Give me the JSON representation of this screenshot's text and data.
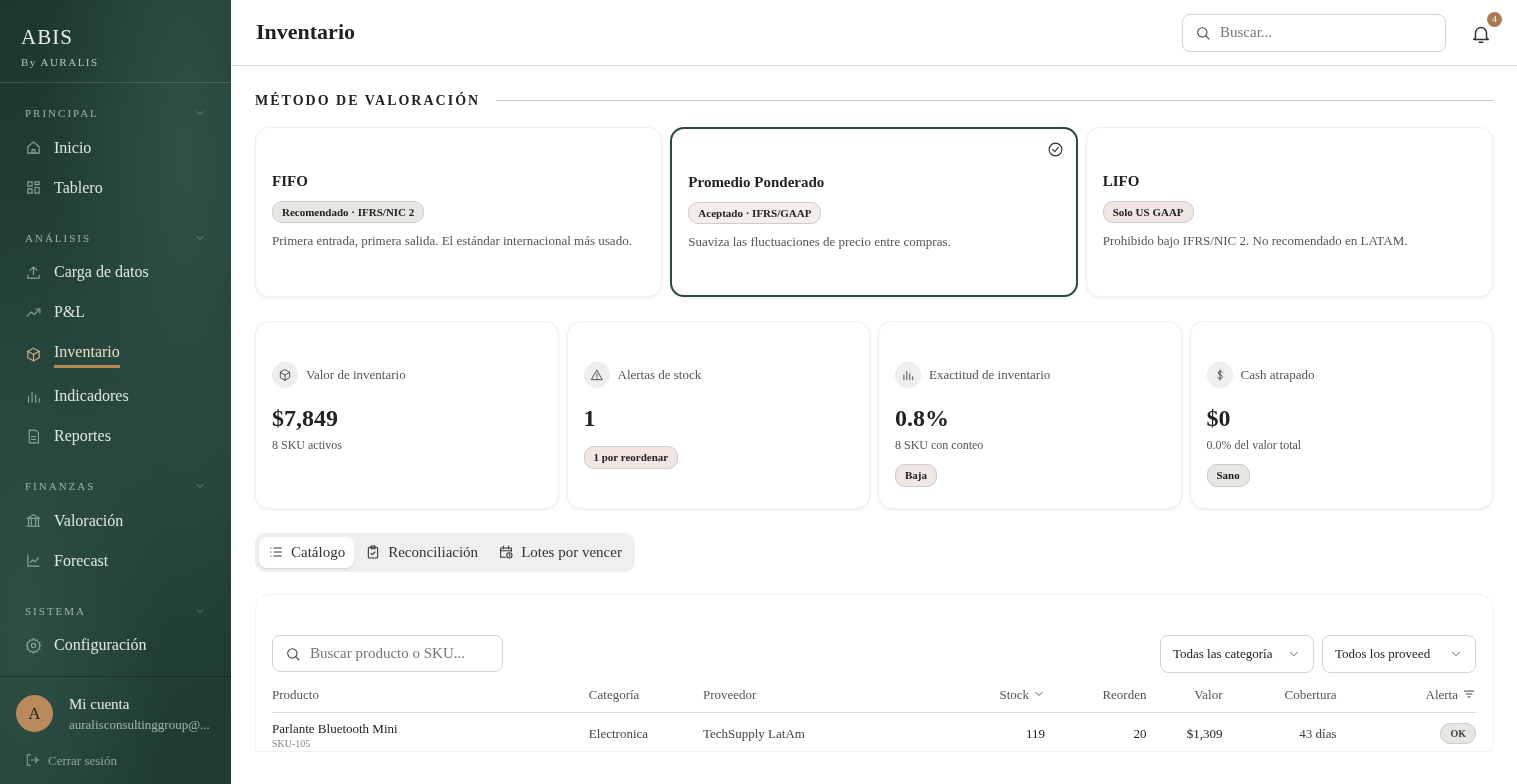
{
  "brand": {
    "name": "ABIS",
    "tagline": "By AURALIS"
  },
  "sidebar": {
    "sections": [
      {
        "label": "PRINCIPAL",
        "expanded": true,
        "items": [
          {
            "label": "Inicio",
            "selected": false
          },
          {
            "label": "Tablero",
            "selected": false
          }
        ]
      },
      {
        "label": "ANÁLISIS",
        "expanded": true,
        "items": [
          {
            "label": "Carga de datos",
            "selected": false
          },
          {
            "label": "P&L",
            "selected": false
          },
          {
            "label": "Inventario",
            "selected": true
          },
          {
            "label": "Indicadores",
            "selected": false
          },
          {
            "label": "Reportes",
            "selected": false
          }
        ]
      },
      {
        "label": "FINANZAS",
        "expanded": true,
        "items": [
          {
            "label": "Valoración",
            "selected": false
          },
          {
            "label": "Forecast",
            "selected": false
          }
        ]
      },
      {
        "label": "SISTEMA",
        "expanded": true,
        "items": [
          {
            "label": "Configuración",
            "selected": false
          }
        ]
      }
    ]
  },
  "account": {
    "initial": "A",
    "name": "Mi cuenta",
    "email": "auralisconsultinggroup@...",
    "logout": "Cerrar sesión"
  },
  "header": {
    "title": "Inventario",
    "search_placeholder": "Buscar...",
    "notifications": "4"
  },
  "valuation": {
    "title": "MÉTODO DE VALORACIÓN",
    "methods": [
      {
        "name": "FIFO",
        "badge": "Recomendado · IFRS/NIC 2",
        "color": "#e4e7e2",
        "description": "Primera entrada, primera salida. El estándar internacional más usado.",
        "selected": false
      },
      {
        "name": "Promedio Ponderado",
        "badge": "Aceptado · IFRS/GAAP",
        "color": "#f5ede9",
        "description": "Suaviza las fluctuaciones de precio entre compras.",
        "selected": true
      },
      {
        "name": "LIFO",
        "badge": "Solo US GAAP",
        "color": "#f0e6e2",
        "description": "Prohibido bajo IFRS/NIC 2. No recomendado en LATAM.",
        "selected": false
      }
    ]
  },
  "kpis": [
    {
      "label": "Valor de inventario",
      "value": "$7,849",
      "sub": "8 SKU activos"
    },
    {
      "label": "Alertas de stock",
      "value": "1",
      "badge": "1 por reordenar",
      "color": "#f3e6e2"
    },
    {
      "label": "Exactitud de inventario",
      "value": "0.8%",
      "sub": "8 SKU con conteo",
      "badge": "Baja",
      "color": "#f1e7e3"
    },
    {
      "label": "Cash atrapado",
      "value": "$0",
      "sub": "0.0% del valor total",
      "badge": "Sano",
      "color": "#e4e7e2"
    }
  ],
  "tabs": [
    {
      "label": "Catálogo",
      "selected": true
    },
    {
      "label": "Reconciliación",
      "selected": false
    },
    {
      "label": "Lotes por vencer",
      "selected": false
    }
  ],
  "table": {
    "search_placeholder": "Buscar producto o SKU...",
    "filters": [
      "Todas las categoría",
      "Todos los proveed"
    ],
    "columns": [
      {
        "label": "Producto"
      },
      {
        "label": "Categoría"
      },
      {
        "label": "Proveedor"
      },
      {
        "label": "Stock",
        "sorted": true
      },
      {
        "label": "Reorden"
      },
      {
        "label": "Valor"
      },
      {
        "label": "Cobertura"
      },
      {
        "label": "Alerta",
        "filter": true
      }
    ],
    "rows": [
      {
        "product": "Parlante Bluetooth Mini",
        "sku": "SKU-105",
        "category": "Electronica",
        "supplier": "TechSupply LatAm",
        "stock": "119",
        "reorder": "20",
        "value": "$1,309",
        "coverage": "43 días",
        "alert": "OK"
      }
    ]
  }
}
